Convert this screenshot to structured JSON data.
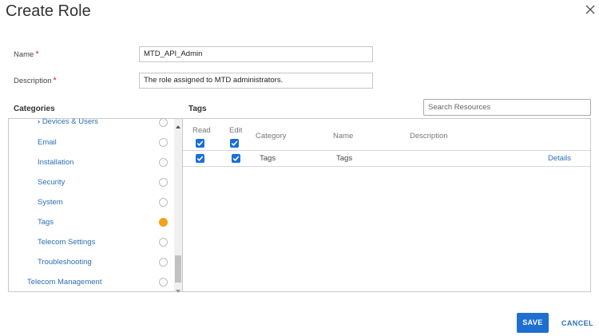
{
  "dialog": {
    "title": "Create Role",
    "close_icon": "close-icon"
  },
  "form": {
    "name_label": "Name",
    "name_value": "MTD_API_Admin",
    "description_label": "Description",
    "description_value": "The role assigned to MTD administrators.",
    "required_mark": "*"
  },
  "categories": {
    "heading": "Categories",
    "items": [
      {
        "label": "Devices & Users",
        "expand_icon": "chevron-right-icon",
        "selected": false
      },
      {
        "label": "Email",
        "selected": false
      },
      {
        "label": "Installation",
        "selected": false
      },
      {
        "label": "Security",
        "selected": false
      },
      {
        "label": "System",
        "selected": false
      },
      {
        "label": "Tags",
        "selected": true
      },
      {
        "label": "Telecom Settings",
        "selected": false
      },
      {
        "label": "Troubleshooting",
        "selected": false
      },
      {
        "label": "Telecom Management",
        "selected": false
      }
    ]
  },
  "tags": {
    "heading": "Tags",
    "search_placeholder": "Search Resources",
    "columns": {
      "read": "Read",
      "edit": "Edit",
      "category": "Category",
      "name": "Name",
      "description": "Description"
    },
    "header_read_checked": true,
    "header_edit_checked": true,
    "rows": [
      {
        "read": true,
        "edit": true,
        "category": "Tags",
        "name": "Tags",
        "description": "",
        "action": "Details"
      }
    ]
  },
  "footer": {
    "save_label": "SAVE",
    "cancel_label": "CANCEL"
  },
  "colors": {
    "accent": "#1f6fd0",
    "link": "#2a6fb8",
    "selected_radio": "#f2a217",
    "required": "#d9262b"
  }
}
